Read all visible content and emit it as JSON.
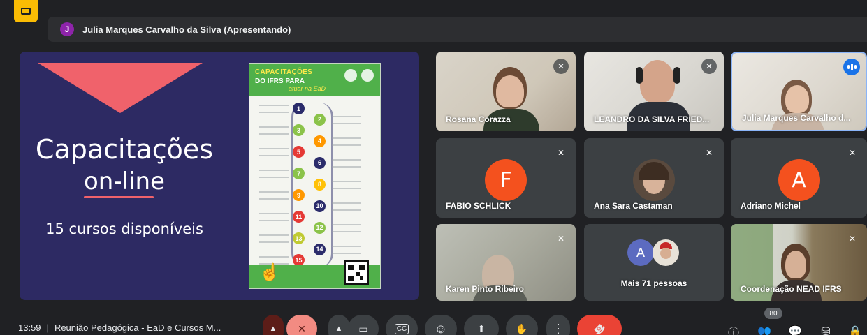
{
  "presenter_bar": {
    "avatar_initial": "J",
    "text": "Julia Marques Carvalho da Silva (Apresentando)"
  },
  "slide": {
    "title_line1": "Capacitações",
    "title_line2": "on-line",
    "subtitle": "15 cursos disponíveis",
    "poster": {
      "heading1": "CAPACITAÇÕES",
      "heading2": "DO IFRS PARA",
      "heading3": "atuar na EaD",
      "nodes": [
        "1",
        "2",
        "3",
        "4",
        "5",
        "6",
        "7",
        "8",
        "9",
        "10",
        "11",
        "12",
        "13",
        "14",
        "15"
      ]
    }
  },
  "participants": [
    {
      "name": "Rosana Corazza",
      "muted": true,
      "video": true
    },
    {
      "name": "LEANDRO DA SILVA FRIED...",
      "muted": true,
      "video": true
    },
    {
      "name": "Julia Marques Carvalho d...",
      "muted": false,
      "video": true,
      "speaking": true
    },
    {
      "name": "FABIO SCHLICK",
      "muted": true,
      "video": false,
      "initial": "F",
      "avatar_color": "#f4511e"
    },
    {
      "name": "Ana Sara Castaman",
      "muted": true,
      "video": false
    },
    {
      "name": "Adriano Michel",
      "muted": true,
      "video": false,
      "initial": "A",
      "avatar_color": "#f4511e"
    },
    {
      "name": "Karen Pinto Ribeiro",
      "muted": true,
      "video": true
    },
    {
      "name": "Coordenação NEAD IFRS",
      "muted": true,
      "video": true
    }
  ],
  "more_tile": {
    "avatar_initial": "A",
    "label": "Mais 71 pessoas"
  },
  "bottom_bar": {
    "time": "13:59",
    "meeting_title": "Reunião Pedagógica - EaD e Cursos M...",
    "participant_count": "80"
  },
  "icons": {
    "mic_off": "🎙",
    "camera": "📹",
    "captions": "CC",
    "emoji": "☺",
    "present": "⬆",
    "hand": "✋",
    "more": "⋮",
    "hangup": "☎",
    "info": "ⓘ",
    "people": "👥",
    "chat": "💬",
    "activities": "⛁",
    "lock": "🔒"
  },
  "colors": {
    "background": "#202124",
    "tile": "#3c4043",
    "accent_red": "#ea4335",
    "slide_bg": "#2d2a63",
    "slide_accent": "#f0626b",
    "poster_green": "#50b04a",
    "speaking_blue": "#1a73e8"
  }
}
